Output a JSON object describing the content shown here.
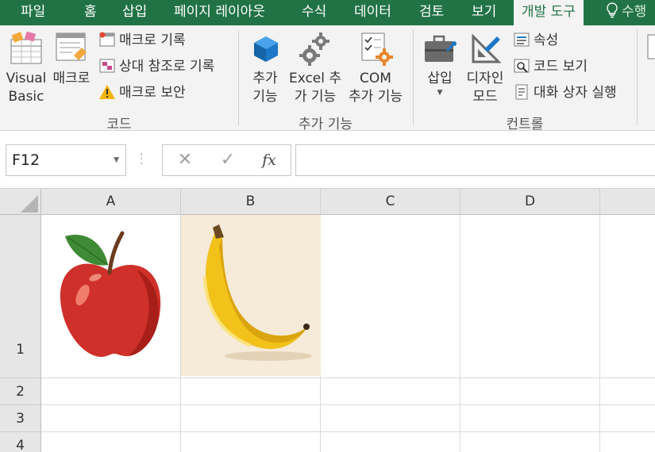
{
  "tabs": [
    {
      "label": "파일",
      "active": false
    },
    {
      "label": "홈",
      "active": false
    },
    {
      "label": "삽입",
      "active": false
    },
    {
      "label": "페이지 레이아웃",
      "active": false
    },
    {
      "label": "수식",
      "active": false
    },
    {
      "label": "데이터",
      "active": false
    },
    {
      "label": "검토",
      "active": false
    },
    {
      "label": "보기",
      "active": false
    },
    {
      "label": "개발 도구",
      "active": true
    }
  ],
  "tell_me": "수행",
  "ribbon": {
    "code_group": {
      "label": "코드",
      "visual_basic": [
        "Visual",
        "Basic"
      ],
      "macros": "매크로",
      "record_macro": "매크로 기록",
      "relative_refs": "상대 참조로 기록",
      "macro_security": "매크로 보안"
    },
    "addins_group": {
      "label": "추가 기능",
      "addins": [
        "추가",
        "기능"
      ],
      "excel_addins": [
        "Excel 추",
        "가 기능"
      ],
      "com_addins": [
        "COM",
        "추가 기능"
      ]
    },
    "controls_group": {
      "label": "컨트롤",
      "insert": "삽입",
      "design_mode": [
        "디자인",
        "모드"
      ],
      "properties": "속성",
      "view_code": "코드 보기",
      "run_dialog": "대화 상자 실행"
    }
  },
  "formula_bar": {
    "name_box": "F12",
    "cancel_glyph": "✕",
    "enter_glyph": "✓",
    "fx_glyph": "fx",
    "formula": ""
  },
  "grid": {
    "columns": [
      "A",
      "B",
      "C",
      "D"
    ],
    "rows": [
      "1",
      "2",
      "3",
      "4"
    ],
    "pictures": [
      {
        "cell": "A1",
        "subject": "apple"
      },
      {
        "cell": "B1",
        "subject": "banana"
      }
    ]
  },
  "colors": {
    "excel_green": "#217346",
    "ribbon_bg": "#f3f3f3",
    "header_bg": "#e6e6e6",
    "apple_red": "#d0302a",
    "banana_yellow": "#f2c21b",
    "banana_bg": "#f6ead8"
  }
}
